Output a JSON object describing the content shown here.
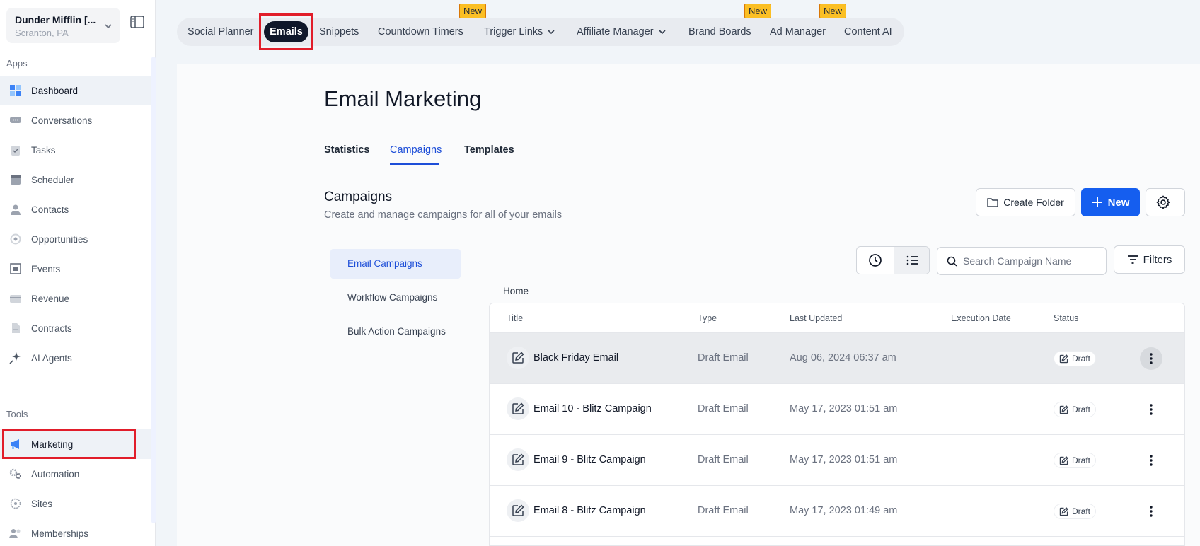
{
  "location": {
    "name": "Dunder Mifflin [...",
    "city": "Scranton, PA"
  },
  "sidebar": {
    "apps_label": "Apps",
    "tools_label": "Tools",
    "apps": [
      {
        "label": "Dashboard",
        "icon": "dashboard-icon"
      },
      {
        "label": "Conversations",
        "icon": "chat-icon"
      },
      {
        "label": "Tasks",
        "icon": "clipboard-icon"
      },
      {
        "label": "Scheduler",
        "icon": "calendar-icon"
      },
      {
        "label": "Contacts",
        "icon": "person-icon"
      },
      {
        "label": "Opportunities",
        "icon": "target-icon"
      },
      {
        "label": "Events",
        "icon": "event-icon"
      },
      {
        "label": "Revenue",
        "icon": "card-icon"
      },
      {
        "label": "Contracts",
        "icon": "document-icon"
      },
      {
        "label": "AI Agents",
        "icon": "sparkle-icon"
      }
    ],
    "tools": [
      {
        "label": "Marketing",
        "icon": "megaphone-icon"
      },
      {
        "label": "Automation",
        "icon": "gears-icon"
      },
      {
        "label": "Sites",
        "icon": "globe-icon"
      },
      {
        "label": "Memberships",
        "icon": "users-icon"
      }
    ]
  },
  "topnav": {
    "items": [
      "Social Planner",
      "Emails",
      "Snippets",
      "Countdown Timers",
      "Trigger Links",
      "Affiliate Manager",
      "Brand Boards",
      "Ad Manager",
      "Content AI"
    ],
    "badge": "New"
  },
  "page": {
    "title": "Email Marketing",
    "tabs": [
      "Statistics",
      "Campaigns",
      "Templates"
    ],
    "section_title": "Campaigns",
    "section_sub": "Create and manage campaigns for all of your emails",
    "create_folder": "Create Folder",
    "new_label": "New",
    "filters_label": "Filters",
    "search_placeholder": "Search Campaign Name",
    "campaign_types": [
      "Email Campaigns",
      "Workflow Campaigns",
      "Bulk Action Campaigns"
    ],
    "breadcrumb": "Home"
  },
  "table": {
    "headers": [
      "Title",
      "Type",
      "Last Updated",
      "Execution Date",
      "Status"
    ],
    "rows": [
      {
        "title": "Black Friday Email",
        "type": "Draft Email",
        "updated": "Aug 06, 2024 06:37 am",
        "status": "Draft"
      },
      {
        "title": "Email 10 - Blitz Campaign",
        "type": "Draft Email",
        "updated": "May 17, 2023 01:51 am",
        "status": "Draft"
      },
      {
        "title": "Email 9 - Blitz Campaign",
        "type": "Draft Email",
        "updated": "May 17, 2023 01:51 am",
        "status": "Draft"
      },
      {
        "title": "Email 8 - Blitz Campaign",
        "type": "Draft Email",
        "updated": "May 17, 2023 01:49 am",
        "status": "Draft"
      }
    ]
  },
  "colors": {
    "accent": "#155eef",
    "highlight": "#e11d2a",
    "badge": "#fbbf24"
  }
}
